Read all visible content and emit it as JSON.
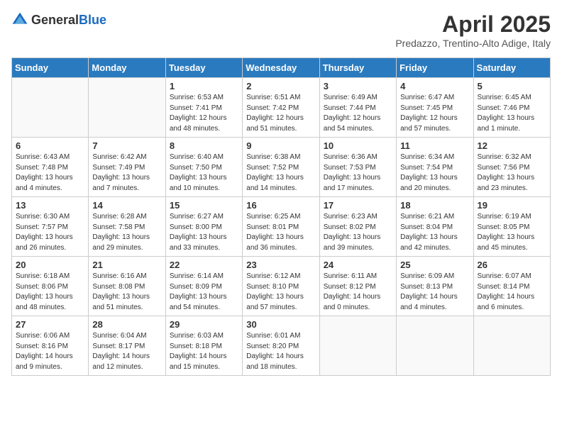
{
  "logo": {
    "text_general": "General",
    "text_blue": "Blue"
  },
  "title": "April 2025",
  "location": "Predazzo, Trentino-Alto Adige, Italy",
  "weekdays": [
    "Sunday",
    "Monday",
    "Tuesday",
    "Wednesday",
    "Thursday",
    "Friday",
    "Saturday"
  ],
  "weeks": [
    [
      {
        "day": "",
        "info": ""
      },
      {
        "day": "",
        "info": ""
      },
      {
        "day": "1",
        "info": "Sunrise: 6:53 AM\nSunset: 7:41 PM\nDaylight: 12 hours and 48 minutes."
      },
      {
        "day": "2",
        "info": "Sunrise: 6:51 AM\nSunset: 7:42 PM\nDaylight: 12 hours and 51 minutes."
      },
      {
        "day": "3",
        "info": "Sunrise: 6:49 AM\nSunset: 7:44 PM\nDaylight: 12 hours and 54 minutes."
      },
      {
        "day": "4",
        "info": "Sunrise: 6:47 AM\nSunset: 7:45 PM\nDaylight: 12 hours and 57 minutes."
      },
      {
        "day": "5",
        "info": "Sunrise: 6:45 AM\nSunset: 7:46 PM\nDaylight: 13 hours and 1 minute."
      }
    ],
    [
      {
        "day": "6",
        "info": "Sunrise: 6:43 AM\nSunset: 7:48 PM\nDaylight: 13 hours and 4 minutes."
      },
      {
        "day": "7",
        "info": "Sunrise: 6:42 AM\nSunset: 7:49 PM\nDaylight: 13 hours and 7 minutes."
      },
      {
        "day": "8",
        "info": "Sunrise: 6:40 AM\nSunset: 7:50 PM\nDaylight: 13 hours and 10 minutes."
      },
      {
        "day": "9",
        "info": "Sunrise: 6:38 AM\nSunset: 7:52 PM\nDaylight: 13 hours and 14 minutes."
      },
      {
        "day": "10",
        "info": "Sunrise: 6:36 AM\nSunset: 7:53 PM\nDaylight: 13 hours and 17 minutes."
      },
      {
        "day": "11",
        "info": "Sunrise: 6:34 AM\nSunset: 7:54 PM\nDaylight: 13 hours and 20 minutes."
      },
      {
        "day": "12",
        "info": "Sunrise: 6:32 AM\nSunset: 7:56 PM\nDaylight: 13 hours and 23 minutes."
      }
    ],
    [
      {
        "day": "13",
        "info": "Sunrise: 6:30 AM\nSunset: 7:57 PM\nDaylight: 13 hours and 26 minutes."
      },
      {
        "day": "14",
        "info": "Sunrise: 6:28 AM\nSunset: 7:58 PM\nDaylight: 13 hours and 29 minutes."
      },
      {
        "day": "15",
        "info": "Sunrise: 6:27 AM\nSunset: 8:00 PM\nDaylight: 13 hours and 33 minutes."
      },
      {
        "day": "16",
        "info": "Sunrise: 6:25 AM\nSunset: 8:01 PM\nDaylight: 13 hours and 36 minutes."
      },
      {
        "day": "17",
        "info": "Sunrise: 6:23 AM\nSunset: 8:02 PM\nDaylight: 13 hours and 39 minutes."
      },
      {
        "day": "18",
        "info": "Sunrise: 6:21 AM\nSunset: 8:04 PM\nDaylight: 13 hours and 42 minutes."
      },
      {
        "day": "19",
        "info": "Sunrise: 6:19 AM\nSunset: 8:05 PM\nDaylight: 13 hours and 45 minutes."
      }
    ],
    [
      {
        "day": "20",
        "info": "Sunrise: 6:18 AM\nSunset: 8:06 PM\nDaylight: 13 hours and 48 minutes."
      },
      {
        "day": "21",
        "info": "Sunrise: 6:16 AM\nSunset: 8:08 PM\nDaylight: 13 hours and 51 minutes."
      },
      {
        "day": "22",
        "info": "Sunrise: 6:14 AM\nSunset: 8:09 PM\nDaylight: 13 hours and 54 minutes."
      },
      {
        "day": "23",
        "info": "Sunrise: 6:12 AM\nSunset: 8:10 PM\nDaylight: 13 hours and 57 minutes."
      },
      {
        "day": "24",
        "info": "Sunrise: 6:11 AM\nSunset: 8:12 PM\nDaylight: 14 hours and 0 minutes."
      },
      {
        "day": "25",
        "info": "Sunrise: 6:09 AM\nSunset: 8:13 PM\nDaylight: 14 hours and 4 minutes."
      },
      {
        "day": "26",
        "info": "Sunrise: 6:07 AM\nSunset: 8:14 PM\nDaylight: 14 hours and 6 minutes."
      }
    ],
    [
      {
        "day": "27",
        "info": "Sunrise: 6:06 AM\nSunset: 8:16 PM\nDaylight: 14 hours and 9 minutes."
      },
      {
        "day": "28",
        "info": "Sunrise: 6:04 AM\nSunset: 8:17 PM\nDaylight: 14 hours and 12 minutes."
      },
      {
        "day": "29",
        "info": "Sunrise: 6:03 AM\nSunset: 8:18 PM\nDaylight: 14 hours and 15 minutes."
      },
      {
        "day": "30",
        "info": "Sunrise: 6:01 AM\nSunset: 8:20 PM\nDaylight: 14 hours and 18 minutes."
      },
      {
        "day": "",
        "info": ""
      },
      {
        "day": "",
        "info": ""
      },
      {
        "day": "",
        "info": ""
      }
    ]
  ]
}
